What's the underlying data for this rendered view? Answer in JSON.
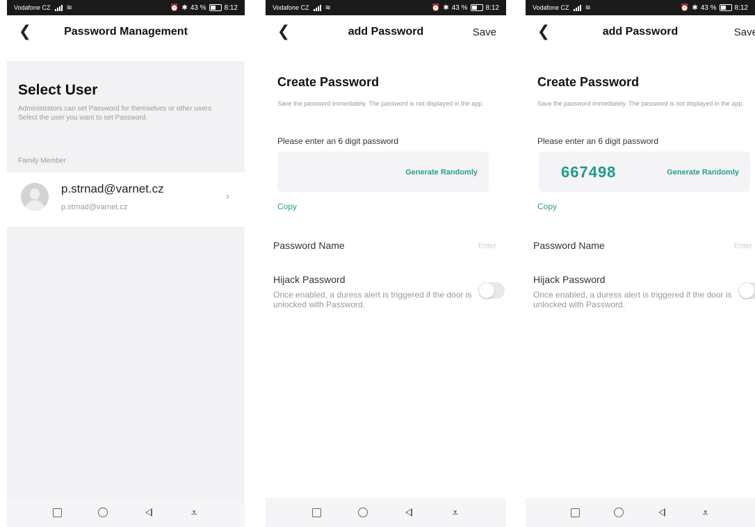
{
  "status": {
    "carrier": "Vodafone CZ",
    "battery": "43 %",
    "time": "8:12"
  },
  "screen1": {
    "title": "Password Management",
    "heading": "Select User",
    "description": "Administrators can set Password for themselves or other users. Select the user you want to set Password.",
    "section_label": "Family Member",
    "users": [
      {
        "name": "p.strnad@varnet.cz",
        "sub": "p.strnad@varnet.cz"
      }
    ]
  },
  "screen2": {
    "title": "add Password",
    "save_label": "Save",
    "heading": "Create Password",
    "description": "Save the password immediately. The password is not displayed in the app.",
    "prompt": "Please enter an 6 digit password",
    "password_value": "",
    "generate_label": "Generate Randomly",
    "copy_label": "Copy",
    "name_label": "Password Name",
    "name_placeholder": "Enter",
    "hijack_label": "Hijack Password",
    "hijack_desc": "Once enabled, a duress alert is triggered if the door is unlocked with Password.",
    "hijack_enabled": false
  },
  "screen3": {
    "title": "add Password",
    "save_label": "Save",
    "heading": "Create Password",
    "description": "Save the password immediately. The password is not displayed in the app.",
    "prompt": "Please enter an 6 digit password",
    "password_value": "667498",
    "generate_label": "Generate Randomly",
    "copy_label": "Copy",
    "name_label": "Password Name",
    "name_placeholder": "Enter",
    "hijack_label": "Hijack Password",
    "hijack_desc": "Once enabled, a duress alert is triggered if the door is unlocked with Password.",
    "hijack_enabled": false
  },
  "icons": {
    "back": "chevron-left-icon",
    "chevron": "chevron-right-icon",
    "avatar": "user-avatar-icon"
  },
  "colors": {
    "accent": "#2a9d8f",
    "status_bar": "#1a1a1a",
    "sys_nav_bg": "#f5f5f7"
  }
}
